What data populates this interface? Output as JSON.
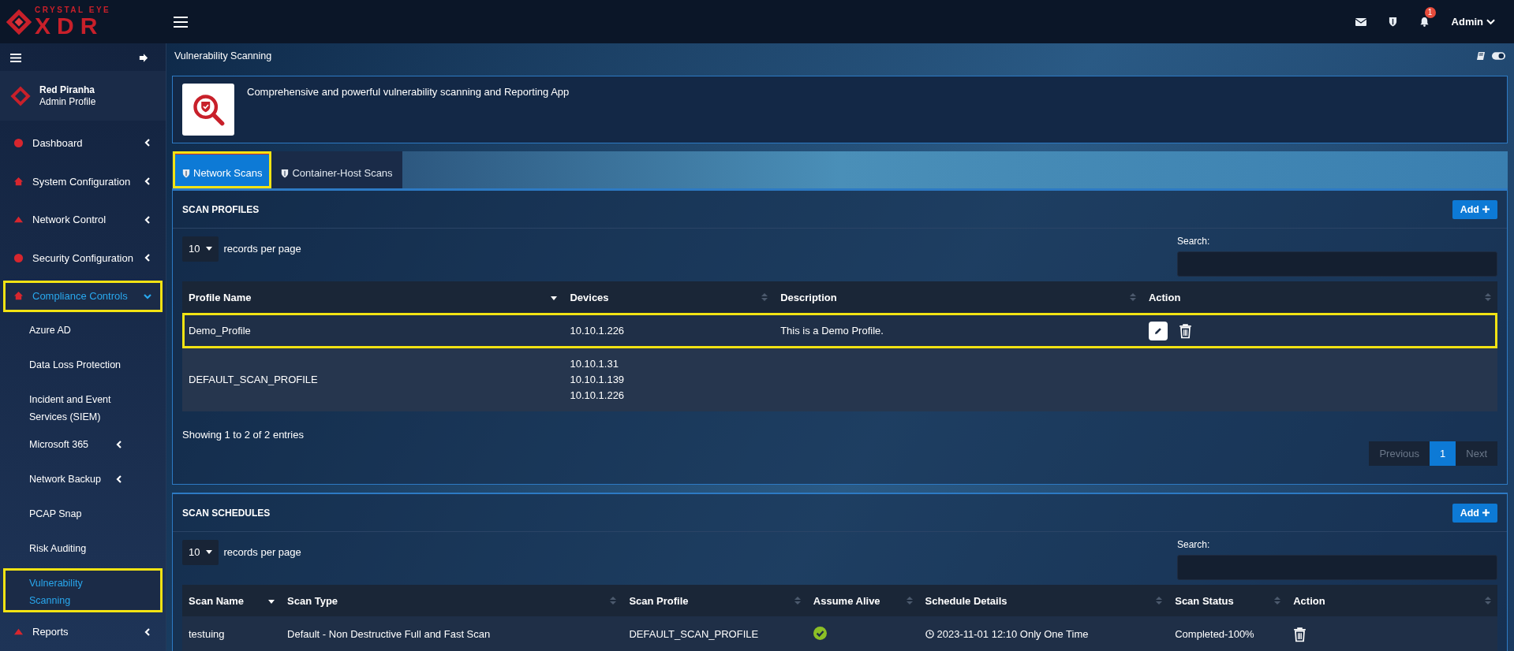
{
  "brand": {
    "top": "CRYSTAL EYE",
    "bottom": "XDR"
  },
  "header": {
    "notification_count": "1",
    "user": "Admin"
  },
  "sidebar": {
    "org": "Red Piranha",
    "profile": "Admin Profile",
    "items": [
      {
        "label": "Dashboard",
        "kind": "group",
        "expanded": false,
        "selected": false,
        "highlighted": false
      },
      {
        "label": "System Configuration",
        "kind": "group",
        "expanded": false,
        "selected": false,
        "highlighted": false
      },
      {
        "label": "Network Control",
        "kind": "group",
        "expanded": false,
        "selected": false,
        "highlighted": false
      },
      {
        "label": "Security Configuration",
        "kind": "group",
        "expanded": false,
        "selected": false,
        "highlighted": false
      },
      {
        "label": "Compliance Controls",
        "kind": "group",
        "expanded": true,
        "selected": true,
        "highlighted": true,
        "children": [
          {
            "label": "Azure AD",
            "kind": "link",
            "selected": false,
            "highlighted": false
          },
          {
            "label": "Data Loss Protection",
            "kind": "link",
            "selected": false,
            "highlighted": false
          },
          {
            "label": "Incident and Event Services (SIEM)",
            "kind": "link",
            "selected": false,
            "highlighted": false
          },
          {
            "label": "Microsoft 365",
            "kind": "group",
            "expanded": false,
            "selected": false,
            "highlighted": false
          },
          {
            "label": "Network Backup",
            "kind": "group",
            "expanded": false,
            "selected": false,
            "highlighted": false
          },
          {
            "label": "PCAP Snap",
            "kind": "link",
            "selected": false,
            "highlighted": false
          },
          {
            "label": "Risk Auditing",
            "kind": "link",
            "selected": false,
            "highlighted": false
          },
          {
            "label": "Vulnerability Scanning",
            "kind": "link",
            "selected": true,
            "highlighted": true
          }
        ]
      },
      {
        "label": "Reports",
        "kind": "group",
        "expanded": false,
        "selected": false,
        "highlighted": false
      }
    ]
  },
  "page": {
    "title": "Vulnerability Scanning",
    "intro": "Comprehensive and powerful vulnerability scanning and Reporting App"
  },
  "tabs": [
    {
      "label": "Network Scans",
      "selected": true,
      "highlighted": true
    },
    {
      "label": "Container-Host Scans",
      "selected": false,
      "highlighted": false
    }
  ],
  "panels": [
    {
      "title": "SCAN PROFILES",
      "add": "Add",
      "page_size": "10",
      "page_size_label": "records per page",
      "search_label": "Search:",
      "columns": [
        {
          "label": "Profile Name",
          "sorted": true
        },
        {
          "label": "Devices",
          "sorted": false
        },
        {
          "label": "Description",
          "sorted": false
        },
        {
          "label": "Action",
          "sorted": false
        }
      ],
      "rows": [
        {
          "highlighted": true,
          "cells": [
            {
              "kind": "text",
              "lines": [
                "Demo_Profile"
              ]
            },
            {
              "kind": "text",
              "lines": [
                "10.10.1.226"
              ]
            },
            {
              "kind": "text",
              "lines": [
                "This is a Demo Profile."
              ]
            },
            {
              "kind": "actions",
              "actions": [
                {
                  "kind": "edit"
                },
                {
                  "kind": "delete"
                }
              ]
            }
          ]
        },
        {
          "highlighted": false,
          "cells": [
            {
              "kind": "text",
              "lines": [
                "DEFAULT_SCAN_PROFILE"
              ]
            },
            {
              "kind": "text",
              "lines": [
                "10.10.1.31",
                "10.10.1.139",
                "10.10.1.226"
              ]
            },
            {
              "kind": "blank"
            },
            {
              "kind": "blank"
            }
          ]
        }
      ],
      "info": "Showing 1 to 2 of 2 entries",
      "pagination": {
        "previous": "Previous",
        "pages": [
          {
            "label": "1",
            "selected": true
          }
        ],
        "next": "Next"
      }
    },
    {
      "title": "SCAN SCHEDULES",
      "add": "Add",
      "page_size": "10",
      "page_size_label": "records per page",
      "search_label": "Search:",
      "columns": [
        {
          "label": "Scan Name",
          "sorted": true
        },
        {
          "label": "Scan Type",
          "sorted": false
        },
        {
          "label": "Scan Profile",
          "sorted": false
        },
        {
          "label": "Assume Alive",
          "sorted": false
        },
        {
          "label": "Schedule Details",
          "sorted": false
        },
        {
          "label": "Scan Status",
          "sorted": false
        },
        {
          "label": "Action",
          "sorted": false
        }
      ],
      "rows": [
        {
          "highlighted": false,
          "cells": [
            {
              "kind": "text",
              "lines": [
                "testuing"
              ]
            },
            {
              "kind": "text",
              "lines": [
                "Default - Non Destructive Full and Fast Scan"
              ]
            },
            {
              "kind": "text",
              "lines": [
                "DEFAULT_SCAN_PROFILE"
              ]
            },
            {
              "kind": "check",
              "checked": true
            },
            {
              "kind": "schedule",
              "lines": [
                "2023-11-01 12:10 Only One Time"
              ]
            },
            {
              "kind": "text",
              "lines": [
                "Completed-100%"
              ]
            },
            {
              "kind": "actions",
              "actions": [
                {
                  "kind": "delete"
                }
              ]
            }
          ]
        }
      ]
    }
  ]
}
